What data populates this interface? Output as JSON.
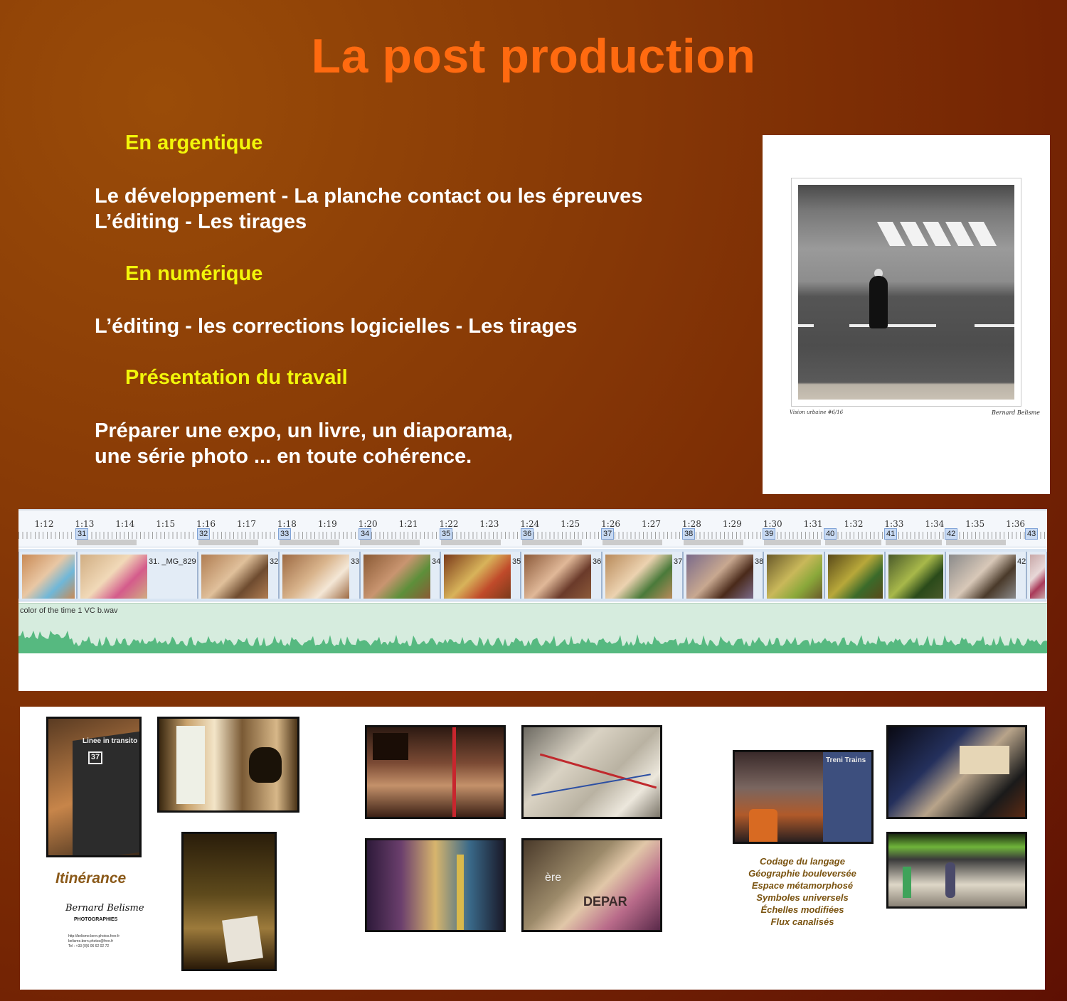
{
  "title": "La post production",
  "sections": [
    {
      "heading": "En argentique",
      "lines": [
        "Le développement - La planche contact ou les épreuves",
        "L’éditing - Les tirages"
      ]
    },
    {
      "heading": "En numérique",
      "lines": [
        "L’éditing - les corrections logicielles - Les tirages"
      ]
    },
    {
      "heading": "Présentation du travail",
      "lines": [
        "Préparer une expo, un livre, un diaporama,",
        "une série photo ... en toute cohérence."
      ]
    }
  ],
  "print": {
    "caption_left": "Vision urbaine #6/16",
    "signature": "Bernard Belisme"
  },
  "timeline": {
    "time_labels": [
      "1:12",
      "1:13",
      "1:14",
      "1:15",
      "1:16",
      "1:17",
      "1:18",
      "1:19",
      "1:20",
      "1:21",
      "1:22",
      "1:23",
      "1:24",
      "1:25",
      "1:26",
      "1:27",
      "1:28",
      "1:29",
      "1:30",
      "1:31",
      "1:32",
      "1:33",
      "1:34",
      "1:35",
      "1:36"
    ],
    "markers": [
      "31",
      "32",
      "33",
      "34",
      "35",
      "36",
      "37",
      "38",
      "39",
      "40",
      "41",
      "42",
      "43"
    ],
    "clips": [
      {
        "label": ""
      },
      {
        "label": "31. _MG_829"
      },
      {
        "label": "32"
      },
      {
        "label": "33"
      },
      {
        "label": "34"
      },
      {
        "label": "35"
      },
      {
        "label": "36"
      },
      {
        "label": "37"
      },
      {
        "label": "38"
      },
      {
        "label": ""
      },
      {
        "label": ""
      },
      {
        "label": ""
      },
      {
        "label": "42"
      },
      {
        "label": ""
      }
    ],
    "audio_label": "color of the time 1 VC b.wav"
  },
  "samples": {
    "transit_label": "Linee in transito",
    "bus_number": "37",
    "itinerance_title": "Itinérance",
    "signature_name": "Bernard Belisme",
    "signature_sub": "PHOTOGRAPHIES",
    "contact_lines": [
      "http://belisme.bern.photos.free.fr",
      "belisme.bern.photos@free.fr",
      "Tel : +33 (0)6 06 62 02 72"
    ],
    "train_brand": "Treni Trains",
    "class_label": "ère",
    "depart_label": "DEPAR",
    "concepts": [
      "Codage du langage",
      "Géographie bouleversée",
      "Espace métamorphosé",
      "Symboles universels",
      "Échelles modifiées",
      "Flux canalisés"
    ]
  }
}
